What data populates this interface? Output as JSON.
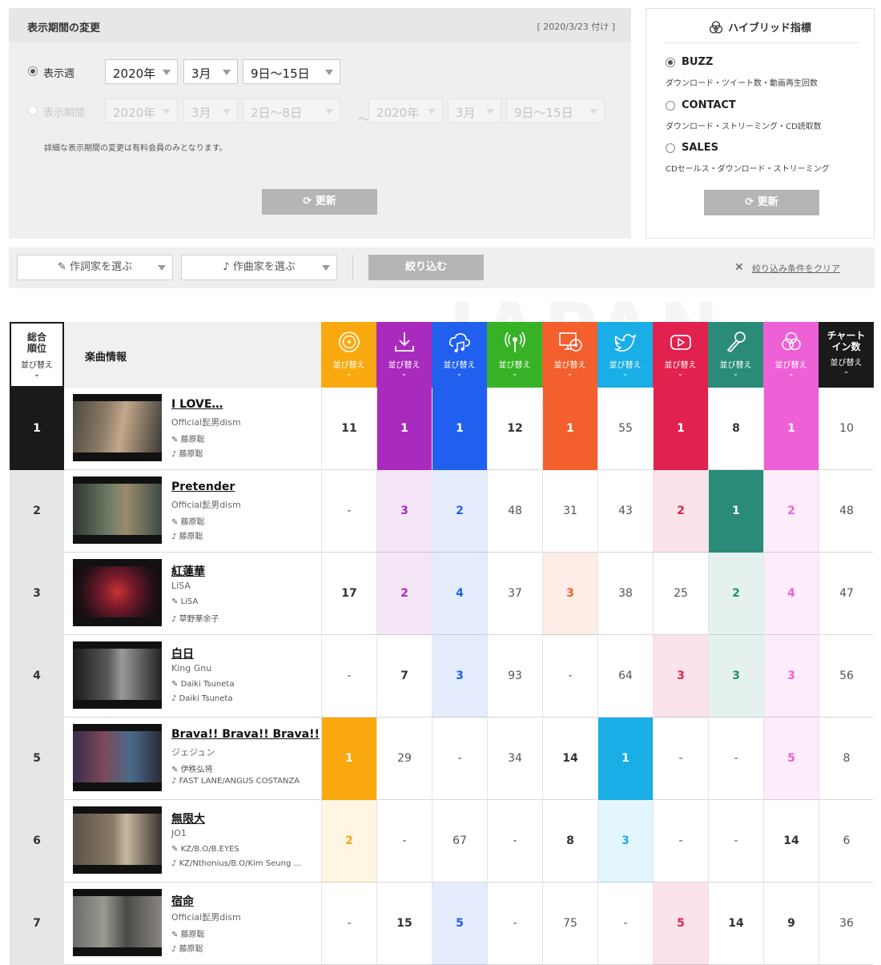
{
  "period": {
    "title": "表示期間の変更",
    "date_note": "[ 2020/3/23 付け ]",
    "week_label": "表示週",
    "week_year": "2020年",
    "week_month": "3月",
    "week_days": "9日〜15日",
    "range_label": "表示期間",
    "range_from_year": "2020年",
    "range_from_month": "3月",
    "range_from_days": "2日〜8日",
    "range_sep": "〜",
    "range_to_year": "2020年",
    "range_to_month": "3月",
    "range_to_days": "9日〜15日",
    "note": "詳細な表示期間の変更は有料会員のみとなります。",
    "update_label": "更新"
  },
  "hybrid": {
    "title": "ハイブリッド指標",
    "options": [
      {
        "label": "BUZZ",
        "desc": "ダウンロード・ツイート数・動画再生回数"
      },
      {
        "label": "CONTACT",
        "desc": "ダウンロード・ストリーミング・CD読取数"
      },
      {
        "label": "SALES",
        "desc": "CDセールス・ダウンロード・ストリーミング"
      }
    ],
    "update_label": "更新"
  },
  "filter": {
    "lyricist_label": "作詞家を選ぶ",
    "composer_label": "作曲家を選ぶ",
    "narrow_label": "絞り込む",
    "clear_label": "絞り込み条件をクリア"
  },
  "watermark": "JAPAN",
  "table": {
    "rank_header": "総合\n順位",
    "sort_label": "並び替え",
    "info_header": "楽曲情報",
    "chart_in_header": "チャート\nイン数",
    "metric_columns": [
      {
        "icon": "cd-icon",
        "color": "#f9a90f"
      },
      {
        "icon": "download-icon",
        "color": "#a82bbd"
      },
      {
        "icon": "cloud-music-icon",
        "color": "#2160ee"
      },
      {
        "icon": "broadcast-icon",
        "color": "#37b226"
      },
      {
        "icon": "pc-cd-icon",
        "color": "#f45f2e"
      },
      {
        "icon": "twitter-icon",
        "color": "#1aaee7"
      },
      {
        "icon": "youtube-icon",
        "color": "#e1214e"
      },
      {
        "icon": "karaoke-mic-icon",
        "color": "#2a8b78"
      },
      {
        "icon": "hybrid-icon",
        "color": "#ee60d6"
      }
    ],
    "chart_in_color": "#1a1a1a",
    "rows": [
      {
        "rank": "1",
        "title": "I LOVE…",
        "artist": "Official髭男dism",
        "lyricist": "藤原聡",
        "composer": "藤原聡",
        "cells": [
          "11",
          "1",
          "1",
          "12",
          "1",
          "55",
          "1",
          "8",
          "1",
          "10"
        ]
      },
      {
        "rank": "2",
        "title": "Pretender",
        "artist": "Official髭男dism",
        "lyricist": "藤原聡",
        "composer": "藤原聡",
        "cells": [
          "-",
          "3",
          "2",
          "48",
          "31",
          "43",
          "2",
          "1",
          "2",
          "48"
        ]
      },
      {
        "rank": "3",
        "title": "紅蓮華",
        "artist": "LiSA",
        "lyricist": "LiSA",
        "composer": "草野華余子",
        "cells": [
          "17",
          "2",
          "4",
          "37",
          "3",
          "38",
          "25",
          "2",
          "4",
          "47"
        ]
      },
      {
        "rank": "4",
        "title": "白日",
        "artist": "King Gnu",
        "lyricist": "Daiki Tsuneta",
        "composer": "Daiki Tsuneta",
        "cells": [
          "-",
          "7",
          "3",
          "93",
          "-",
          "64",
          "3",
          "3",
          "3",
          "56"
        ]
      },
      {
        "rank": "5",
        "title": "Brava!! Brava!! Brava!!",
        "artist": "ジェジュン",
        "lyricist": "伊秩弘将",
        "composer": "FAST LANE/ANGUS COSTANZA",
        "cells": [
          "1",
          "29",
          "-",
          "34",
          "14",
          "1",
          "-",
          "-",
          "5",
          "8"
        ]
      },
      {
        "rank": "6",
        "title": "無限大",
        "artist": "JO1",
        "lyricist": "KZ/B.O/B.EYES",
        "composer": "KZ/Nthonius/B.O/Kim Seung ...",
        "cells": [
          "2",
          "-",
          "67",
          "-",
          "8",
          "3",
          "-",
          "-",
          "14",
          "6"
        ]
      },
      {
        "rank": "7",
        "title": "宿命",
        "artist": "Official髭男dism",
        "lyricist": "藤原聡",
        "composer": "藤原聡",
        "cells": [
          "-",
          "15",
          "5",
          "-",
          "75",
          "-",
          "5",
          "14",
          "9",
          "36"
        ]
      }
    ]
  }
}
